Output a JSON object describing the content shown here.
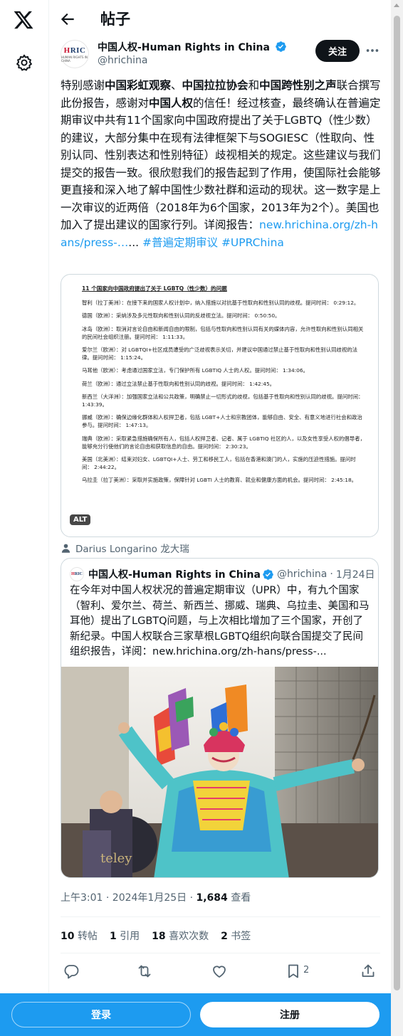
{
  "header": {
    "title": "帖子"
  },
  "author": {
    "name": "中国人权-Human Rights in China",
    "handle": "@hrichina",
    "logo_text": "HRIC",
    "logo_subtext": "HUMAN RIGHTS IN CHINA"
  },
  "follow_label": "关注",
  "post": {
    "segments": [
      {
        "t": "特别感谢"
      },
      {
        "t": "中国彩虹观察",
        "b": true
      },
      {
        "t": "、"
      },
      {
        "t": "中国拉拉协会",
        "b": true
      },
      {
        "t": "和"
      },
      {
        "t": "中国跨性别之声",
        "b": true
      },
      {
        "t": "联合撰写此份报告，感谢对"
      },
      {
        "t": "中国人权",
        "b": true
      },
      {
        "t": "的信任！经过核查，最终确认在普遍定期审议中共有11个国家向中国政府提出了关于LGBTQ（性少数）的建议，大部分集中在现有法律框架下与SOGIESC（性取向、性别认同、性别表达和性别特征）歧视相关的规定。这些建议与我们提交的报告一致。很欣慰我们的报告起到了作用，使国际社会能够更直接和深入地了解中国性少数社群和运动的现状。这一数字是上一次审议的近两倍（2018年为6个国家，2013年为2个）。美国也加入了提出建议的国家行列。详阅报告："
      },
      {
        "t": "new.hrichina.org/zh-hans/press-…",
        "link": true
      },
      {
        "t": "... "
      },
      {
        "t": "#普遍定期审议",
        "link": true
      },
      {
        "t": " "
      },
      {
        "t": "#UPRChina",
        "link": true
      }
    ]
  },
  "doc_image": {
    "title": "11 个国家向中国政府提出了关于 LGBTQ（性少数）的问题",
    "entries": [
      "智利（拉丁美洲）：在接下来的国家人权计划中，纳入措施以对抗基于性取向和性别认同的歧视。提问时间： 0:29:12。",
      "德国（欧洲）：采纳涉及多元性取向和性别认同的反歧视立法。提问时间： 0:50:50。",
      "冰岛（欧洲）：取消对言论自由和新闻自由的限制，包括与性取向和性别认同有关的媒体内容，允许性取向和性别认同相关的民间社会组织注册。提问时间： 1:11:33。",
      "爱尔兰（欧洲）：对 LGBTQI+社区成员遭受的广泛歧视表示关切，并建议中国通过禁止基于性取向和性别认同歧视的法律。提问时间： 1:15:24。",
      "马耳他（欧洲）：考虑通过国家立法，专门保护所有 LGBTIQ 人士的人权。提问时间： 1:34:06。",
      "荷兰（欧洲）：通过立法禁止基于性取向和性别认同的歧视。提问时间： 1:42:45。",
      "新西兰（大洋洲）：加强国家立法和公共政策，明确禁止一切形式的歧视，包括基于性取向和性别认同的歧视。提问时间： 1:43:39。",
      "挪威（欧洲）：确保边缘化群体和人权捍卫者，包括 LGBT+人士和宗教团体，能够自由、安全、有意义地进行社会和政治参与。提问时间： 1:47:13。",
      "瑞典（欧洲）：采取紧急措施确保所有人，包括人权捍卫者、记者、属于 LGBTIQ 社区的人，以及女性享受人权的倡导者，能够充分行使他们的言论自由和获取信息的自由。提问时间： 2:30:23。",
      "美国（北美洲）：结束对妇女、LGBTQI+人士、劳工和移民工人，包括在香港和澳门的人，实施的压迫性措施。提问时间： 2:44:22。",
      "乌拉圭（拉丁美洲）：采取并实施政策，保障针对 LGBTI 人士的教育、就业和健康方面的机会。提问时间： 2:45:18。"
    ],
    "alt_badge": "ALT"
  },
  "context_line": "Darius Longarino 龙大瑞",
  "quote": {
    "name": "中国人权-Human Rights in China",
    "handle": "@hrichina",
    "separator": "·",
    "date": "1月24日",
    "text": "在今年对中国人权状况的普遍定期审议（UPR）中，有九个国家（智利、爱尔兰、荷兰、新西兰、挪威、瑞典、乌拉圭、美国和马耳他）提出了LGBTQ问题，与上次相比增加了三个国家，开创了新纪录。中国人权联合三家草根LGBTQ组织向联合国提交了民间组织报告，详阅：new.hrichina.org/zh-hans/press-...",
    "photo_banner_text": "teley"
  },
  "timestamp": {
    "time": "上午3:01 · 2024年1月25日 · ",
    "views_count": "1,684",
    "views_label": " 查看"
  },
  "stats": [
    {
      "count": "10",
      "label": "转帖"
    },
    {
      "count": "1",
      "label": "引用"
    },
    {
      "count": "18",
      "label": "喜欢次数"
    },
    {
      "count": "2",
      "label": "书签"
    }
  ],
  "actions": {
    "bookmark_count": "2"
  },
  "bottom_bar": {
    "login": "登录",
    "signup": "注册"
  },
  "colors": {
    "accent": "#1d9bf0",
    "text": "#0f1419",
    "muted": "#536471",
    "border": "#cfd9de"
  }
}
